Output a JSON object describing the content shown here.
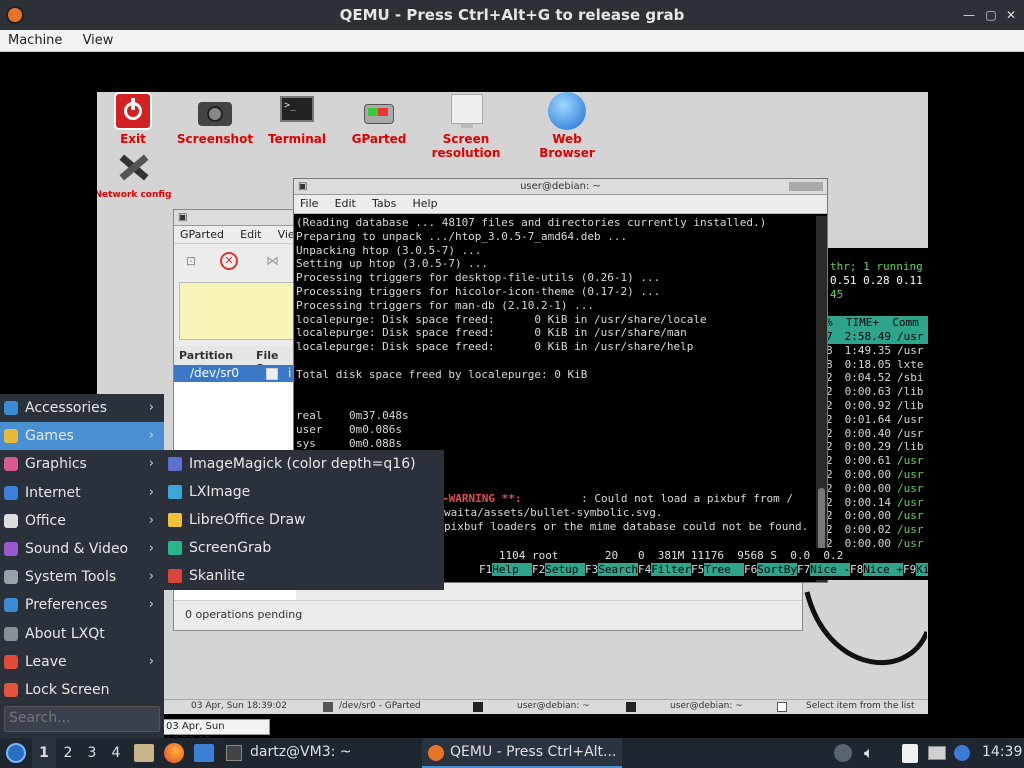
{
  "window": {
    "title": "QEMU - Press Ctrl+Alt+G to release grab"
  },
  "menubar": {
    "machine": "Machine",
    "view": "View"
  },
  "desktop_icons": [
    {
      "label": "Exit"
    },
    {
      "label": "Screenshot"
    },
    {
      "label": "Terminal"
    },
    {
      "label": "GParted"
    },
    {
      "label": "Screen resolution"
    },
    {
      "label": "Web Browser"
    },
    {
      "label": "Network config"
    }
  ],
  "terminal": {
    "title": "user@debian: ~",
    "menu": [
      "File",
      "Edit",
      "Tabs",
      "Help"
    ],
    "lines": [
      "(Reading database ... 48107 files and directories currently installed.)",
      "Preparing to unpack .../htop_3.0.5-7_amd64.deb ...",
      "Unpacking htop (3.0.5-7) ...",
      "Setting up htop (3.0.5-7) ...",
      "Processing triggers for desktop-file-utils (0.26-1) ...",
      "Processing triggers for hicolor-icon-theme (0.17-2) ...",
      "Processing triggers for man-db (2.10.2-1) ...",
      "localepurge: Disk space freed:      0 KiB in /usr/share/locale",
      "localepurge: Disk space freed:      0 KiB in /usr/share/man",
      "localepurge: Disk space freed:      0 KiB in /usr/share/help",
      "",
      "Total disk space freed by localepurge: 0 KiB",
      "",
      "",
      "real    0m37.048s",
      "user    0m0.086s",
      "sys     0m0.088s"
    ],
    "warning_tag": "-WARNING **:",
    "warning_rest": ": Could not load a pixbuf from /",
    "warning_line2": "waita/assets/bullet-symbolic.svg.",
    "warning_line3": "pixbuf loaders or the mime database could not be found."
  },
  "htop": {
    "tasks": "thr; 1 running",
    "load": "0.51 0.28 0.11",
    "uptime": "45",
    "header": "%  TIME+  Comm",
    "rows": [
      {
        "num": "7",
        "time": "2:58.49",
        "cmd": "/usr",
        "hl": true
      },
      {
        "num": "8",
        "time": "1:49.35",
        "cmd": "/usr",
        "hl": false
      },
      {
        "num": "8",
        "time": "0:18.05",
        "cmd": "lxte",
        "hl": false
      },
      {
        "num": "2",
        "time": "0:04.52",
        "cmd": "/sbi",
        "hl": false
      },
      {
        "num": "2",
        "time": "0:00.63",
        "cmd": "/lib",
        "hl": false
      },
      {
        "num": "2",
        "time": "0:00.92",
        "cmd": "/lib",
        "hl": false
      },
      {
        "num": "2",
        "time": "0:01.64",
        "cmd": "/usr",
        "hl": false
      },
      {
        "num": "2",
        "time": "0:00.40",
        "cmd": "/usr",
        "hl": false
      },
      {
        "num": "2",
        "time": "0:00.29",
        "cmd": "/lib",
        "hl": false
      },
      {
        "num": "2",
        "time": "0:00.61",
        "cmd": "/usr",
        "hl": false
      },
      {
        "num": "2",
        "time": "0:00.00",
        "cmd": "/usr",
        "hl": false
      },
      {
        "num": "2",
        "time": "0:00.00",
        "cmd": "/usr",
        "hl": false
      },
      {
        "num": "2",
        "time": "0:00.14",
        "cmd": "/usr",
        "hl": false
      },
      {
        "num": "2",
        "time": "0:00.00",
        "cmd": "/usr",
        "hl": false
      },
      {
        "num": "2",
        "time": "0:00.02",
        "cmd": "/usr",
        "hl": false
      },
      {
        "num": "2",
        "time": "0:00.00",
        "cmd": "/usr",
        "hl": false
      },
      {
        "num": "2",
        "time": "0:00.00",
        "cmd": "/usr",
        "hl": false
      }
    ],
    "bottom_row": "   1104 root       20   0  381M 11176  9568 S  0.0  0.2",
    "fkeys": [
      {
        "key": "F1",
        "label": "Help  "
      },
      {
        "key": "F2",
        "label": "Setup "
      },
      {
        "key": "F3",
        "label": "Search"
      },
      {
        "key": "F4",
        "label": "Filter"
      },
      {
        "key": "F5",
        "label": "Tree  "
      },
      {
        "key": "F6",
        "label": "SortBy"
      },
      {
        "key": "F7",
        "label": "Nice -"
      },
      {
        "key": "F8",
        "label": "Nice +"
      },
      {
        "key": "F9",
        "label": "Kil"
      }
    ]
  },
  "gparted": {
    "menu": [
      "GParted",
      "Edit",
      "View"
    ],
    "col_partition": "Partition",
    "col_fs": "File Sy",
    "row_device": "/dev/sr0",
    "row_extra": "i",
    "status": "0 operations pending"
  },
  "guest_taskbar": {
    "clock": "03 Apr, Sun 18:39:02",
    "tooltip": "03 Apr, Sun 18:39:02",
    "tasks": [
      "/dev/sr0 - GParted",
      "user@debian: ~",
      "user@debian: ~"
    ],
    "hint": "Select item from the list"
  },
  "start_menu": {
    "items": [
      {
        "label": "Accessories",
        "arrow": "›",
        "color": "#3a8bd6"
      },
      {
        "label": "Games",
        "arrow": "›",
        "color": "#e8b93a"
      },
      {
        "label": "Graphics",
        "arrow": "›",
        "color": "#d65a8e"
      },
      {
        "label": "Internet",
        "arrow": "›",
        "color": "#3d7fd9"
      },
      {
        "label": "Office",
        "arrow": "›",
        "color": "#dddddd"
      },
      {
        "label": "Sound & Video",
        "arrow": "›",
        "color": "#9b59d0"
      },
      {
        "label": "System Tools",
        "arrow": "›",
        "color": "#9aa0a8"
      },
      {
        "label": "Preferences",
        "arrow": "›",
        "color": "#3a8bd6"
      },
      {
        "label": "About LXQt",
        "arrow": "",
        "color": "#8a8f96"
      },
      {
        "label": "Leave",
        "arrow": "›",
        "color": "#e04a3a"
      },
      {
        "label": "Lock Screen",
        "arrow": "",
        "color": "#e2553a"
      }
    ],
    "search_placeholder": "Search..."
  },
  "submenu": {
    "items": [
      {
        "label": "ImageMagick (color depth=q16)",
        "color": "#5a6fd0"
      },
      {
        "label": "LXImage",
        "color": "#3aa8d8"
      },
      {
        "label": "LibreOffice Draw",
        "color": "#f0c23a"
      },
      {
        "label": "ScreenGrab",
        "color": "#2bb58a"
      },
      {
        "label": "Skanlite",
        "color": "#d9453a"
      }
    ]
  },
  "host_taskbar": {
    "workspaces": [
      "1",
      "2",
      "3",
      "4"
    ],
    "task1": "dartz@VM3: ~",
    "task2": "QEMU - Press Ctrl+Alt...",
    "clock": "14:39"
  }
}
